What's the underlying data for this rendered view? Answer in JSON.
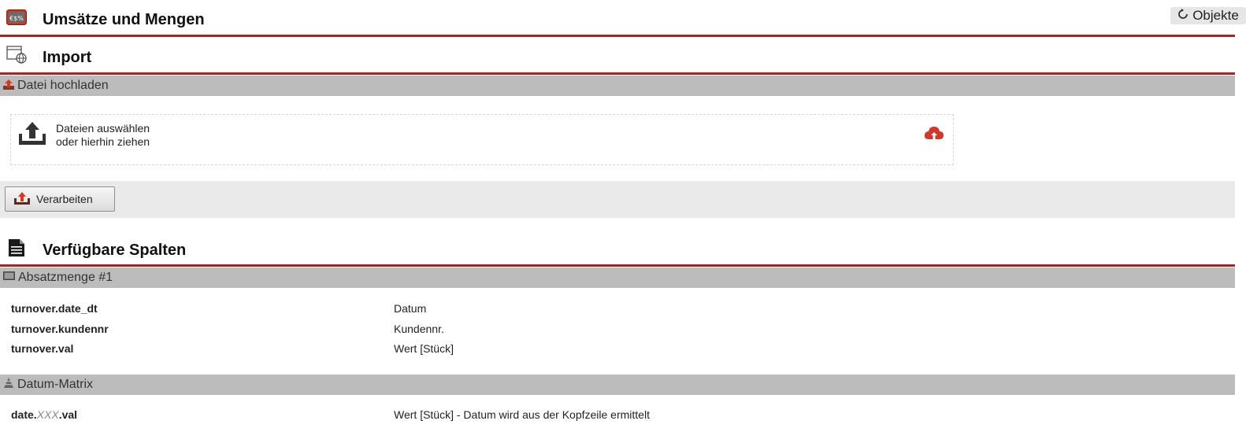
{
  "header": {
    "title": "Umsätze und Mengen",
    "objects_button": "Objekte"
  },
  "import": {
    "title": "Import",
    "upload_section": "Datei hochladen",
    "dropzone": {
      "line1": "Dateien auswählen",
      "line2": "oder hierhin ziehen"
    },
    "process_button": "Verarbeiten"
  },
  "columns": {
    "title": "Verfügbare Spalten",
    "groups": [
      {
        "label": "Absatzmenge #1",
        "rows": [
          {
            "key": "turnover.date_dt",
            "desc": "Datum"
          },
          {
            "key": "turnover.kundennr",
            "desc": "Kundennr."
          },
          {
            "key": "turnover.val",
            "desc": "Wert [Stück]"
          }
        ]
      },
      {
        "label": "Datum-Matrix",
        "rows": [
          {
            "key_prefix": "date.",
            "key_placeholder": "XXX",
            "key_suffix": ".val",
            "desc": "Wert [Stück] - Datum wird aus der Kopfzeile ermittelt"
          }
        ]
      }
    ]
  },
  "colors": {
    "accent": "#a52226",
    "section_bar": "#bdbcbc",
    "toolbar_bg": "#eaeaea"
  }
}
